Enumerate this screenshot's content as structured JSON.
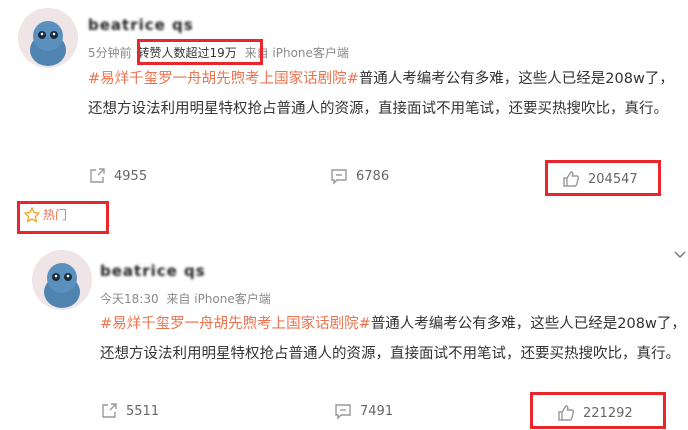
{
  "posts": [
    {
      "time": "5分钟前",
      "highlight": "转赞人数超过19万",
      "source": "来自 iPhone客户端",
      "hashtag": "#易烊千玺罗一舟胡先煦考上国家话剧院#",
      "text": "普通人考编考公有多难，这些人已经是208w了，还想方设法利用明星特权抢占普通人的资源，直接面试不用笔试，还要买热搜吹比，真行。",
      "reposts": "4955",
      "comments": "6786",
      "likes": "204547"
    },
    {
      "time": "今天18:30",
      "source": "来自 iPhone客户端",
      "hashtag": "#易烊千玺罗一舟胡先煦考上国家话剧院#",
      "text": "普通人考编考公有多难，这些人已经是208w了，还想方设法利用明星特权抢占普通人的资源，直接面试不用笔试，还要买热搜吹比，真行。",
      "reposts": "5511",
      "comments": "7491",
      "likes": "221292"
    }
  ],
  "hot_label": "热门",
  "colors": {
    "accent": "#eb7350",
    "highlight_box": "#e8262b"
  }
}
